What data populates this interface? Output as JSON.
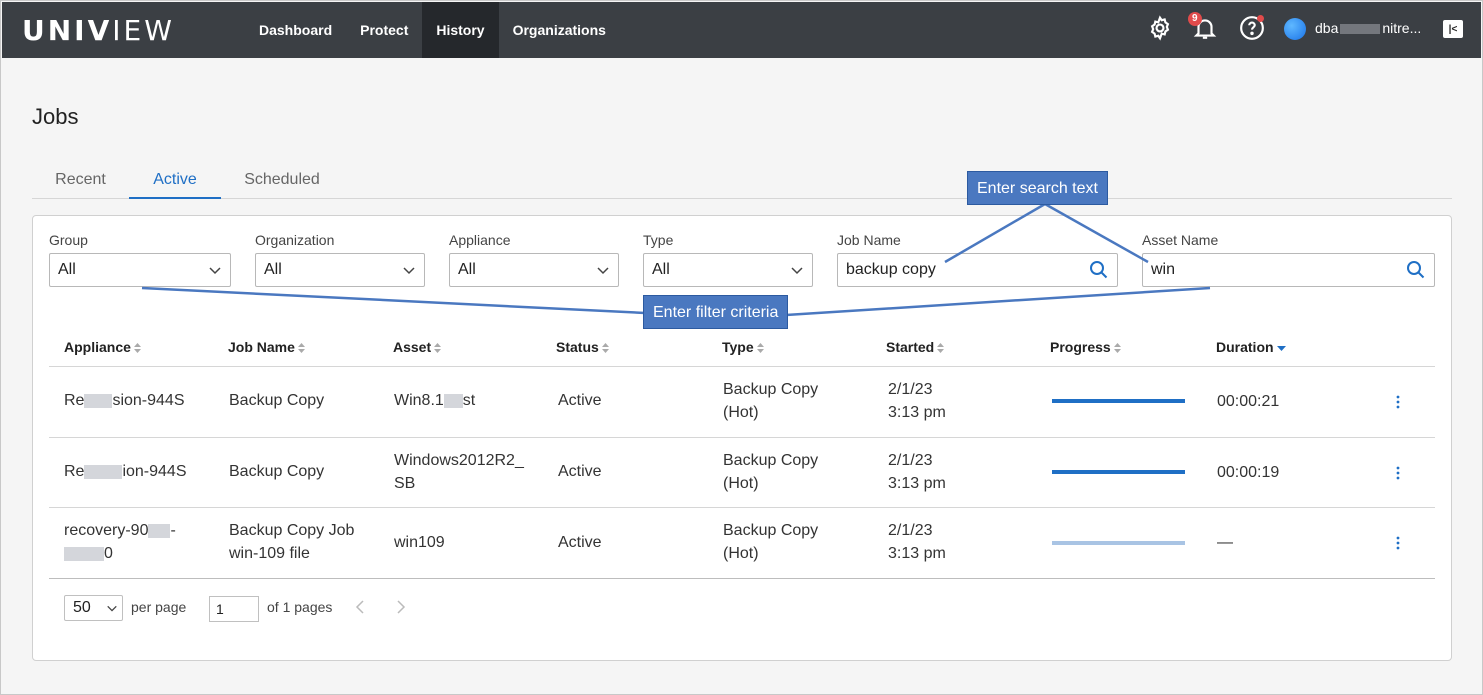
{
  "app": {
    "logo_bold": "UNIV",
    "logo_light": "IEW",
    "nav": [
      "Dashboard",
      "Protect",
      "History",
      "Organizations"
    ],
    "active_nav": "History",
    "notification_count": "9",
    "user_prefix": "dba",
    "user_suffix": "nitre..."
  },
  "page": {
    "title": "Jobs",
    "tabs": [
      "Recent",
      "Active",
      "Scheduled"
    ],
    "active_tab": "Active"
  },
  "filters": {
    "group": {
      "label": "Group",
      "value": "All"
    },
    "organization": {
      "label": "Organization",
      "value": "All"
    },
    "appliance": {
      "label": "Appliance",
      "value": "All"
    },
    "type": {
      "label": "Type",
      "value": "All"
    },
    "job_name": {
      "label": "Job Name",
      "value": "backup copy"
    },
    "asset_name": {
      "label": "Asset Name",
      "value": "win"
    }
  },
  "table": {
    "columns": [
      "Appliance",
      "Job Name",
      "Asset",
      "Status",
      "Type",
      "Started",
      "Progress",
      "Duration"
    ],
    "rows": [
      {
        "appliance_a": "Re",
        "appliance_b": "sion-944S",
        "appliance_c": "",
        "job_name_1": "Backup Copy",
        "job_name_2": "",
        "asset_1": "Win8.1",
        "asset_2": "st",
        "status": "Active",
        "type_1": "Backup Copy",
        "type_2": "(Hot)",
        "started_1": "2/1/23",
        "started_2": "3:13 pm",
        "progress": 1.0,
        "duration": "00:00:21"
      },
      {
        "appliance_a": "Re",
        "appliance_b": "ion-944S",
        "appliance_c": "",
        "job_name_1": "Backup Copy",
        "job_name_2": "",
        "asset_1": "Windows2012R2_",
        "asset_2": "SB",
        "status": "Active",
        "type_1": "Backup Copy",
        "type_2": "(Hot)",
        "started_1": "2/1/23",
        "started_2": "3:13 pm",
        "progress": 1.0,
        "duration": "00:00:19"
      },
      {
        "appliance_a": "recovery-90",
        "appliance_b": "-",
        "appliance_c": "0",
        "job_name_1": "Backup Copy Job",
        "job_name_2": "win-109 file",
        "asset_1": "win109",
        "asset_2": "",
        "status": "Active",
        "type_1": "Backup Copy",
        "type_2": "(Hot)",
        "started_1": "2/1/23",
        "started_2": "3:13 pm",
        "progress": 0.0,
        "duration": "—"
      }
    ]
  },
  "pager": {
    "per_page_value": "50",
    "per_page_label": "per page",
    "page_value": "1",
    "of_pages": "of 1 pages"
  },
  "annotations": {
    "search_text": "Enter search text",
    "filter_criteria": "Enter filter criteria",
    "color": "#4a78c0"
  },
  "colors": {
    "topbar": "#3b3f44",
    "accent": "#1f6fc5"
  }
}
